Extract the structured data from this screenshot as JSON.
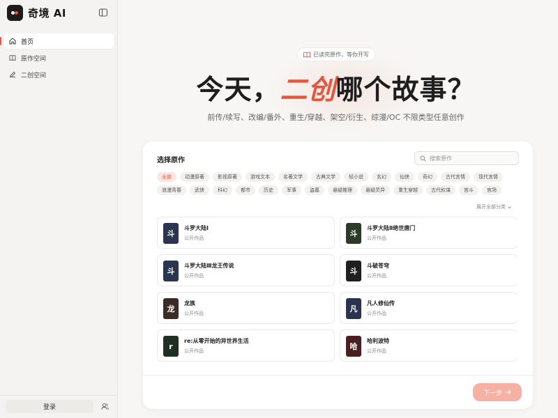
{
  "app": {
    "name": "奇境 AI"
  },
  "sidebar": {
    "items": [
      {
        "label": "首页",
        "icon": "home-icon",
        "active": true
      },
      {
        "label": "原作空间",
        "icon": "book-icon",
        "active": false
      },
      {
        "label": "二创空间",
        "icon": "pen-icon",
        "active": false
      }
    ],
    "login_label": "登录"
  },
  "hero": {
    "badge": "已读完原作，等你开写",
    "headline_pre": "今天，",
    "headline_accent": "二创",
    "headline_post": "哪个故事？",
    "subtitle": "前传/续写、改编/番外、重生/穿越、架空/衍生、综漫/OC 不限类型任意创作"
  },
  "picker": {
    "title": "选择原作",
    "search_placeholder": "搜索原作",
    "tags": [
      "全部",
      "动漫原著",
      "影视原著",
      "游戏文本",
      "名著文学",
      "古典文学",
      "轻小说",
      "玄幻",
      "仙侠",
      "奇幻",
      "古代言情",
      "现代言情",
      "浪漫青春",
      "武侠",
      "科幻",
      "都市",
      "历史",
      "军事",
      "盗墓",
      "悬疑推理",
      "悬疑灵异",
      "重生穿越",
      "古代权谋",
      "宫斗",
      "官场"
    ],
    "active_tag": "全部",
    "expand_label": "展开全部分类",
    "books": [
      {
        "title": "斗罗大陆Ⅰ",
        "cover_char": "斗",
        "cover_color": "#2b3550",
        "subtitle": "公开作品"
      },
      {
        "title": "斗罗大陆Ⅱ绝世唐门",
        "cover_char": "斗",
        "cover_color": "#2c3a26",
        "subtitle": "公开作品"
      },
      {
        "title": "斗罗大陆Ⅲ龙王传说",
        "cover_char": "斗",
        "cover_color": "#2b3550",
        "subtitle": "公开作品"
      },
      {
        "title": "斗破苍穹",
        "cover_char": "斗",
        "cover_color": "#1f1f1f",
        "subtitle": "公开作品"
      },
      {
        "title": "龙族",
        "cover_char": "龙",
        "cover_color": "#3b2c26",
        "subtitle": "公开作品"
      },
      {
        "title": "凡人修仙传",
        "cover_char": "凡",
        "cover_color": "#2a3350",
        "subtitle": "公开作品"
      },
      {
        "title": "re:从零开始的异世界生活",
        "cover_char": "r",
        "cover_color": "#1f2f23",
        "subtitle": "公开作品"
      },
      {
        "title": "哈利波特",
        "cover_char": "哈",
        "cover_color": "#4a1f1f",
        "subtitle": "公开作品"
      }
    ],
    "next_label": "下一步"
  },
  "colors": {
    "accent": "#e8553d",
    "next_button": "#f5b1a3"
  }
}
